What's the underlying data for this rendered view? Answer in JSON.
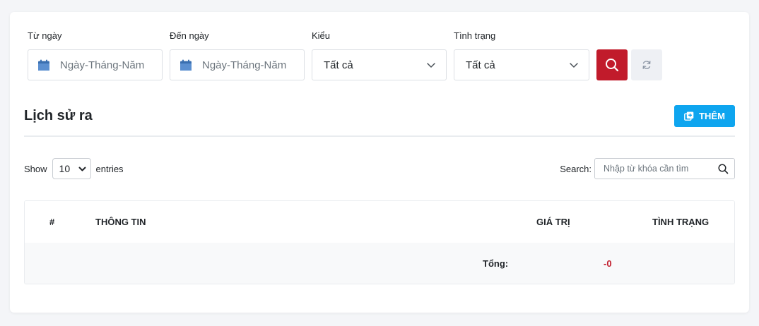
{
  "filters": {
    "from_date": {
      "label": "Từ ngày",
      "placeholder": "Ngày-Tháng-Năm"
    },
    "to_date": {
      "label": "Đến ngày",
      "placeholder": "Ngày-Tháng-Năm"
    },
    "type": {
      "label": "Kiểu",
      "value": "Tất cả"
    },
    "status": {
      "label": "Tình trạng",
      "value": "Tất cả"
    }
  },
  "section": {
    "title": "Lịch sử ra",
    "add_label": "THÊM"
  },
  "table_controls": {
    "show_label": "Show",
    "entries_value": "10",
    "entries_label": "entries",
    "search_label": "Search:",
    "search_placeholder": "Nhập từ khóa cần tìm"
  },
  "table": {
    "headers": [
      "#",
      "THÔNG TIN",
      "GIÁ TRỊ",
      "TÌNH TRẠNG"
    ],
    "footer": {
      "total_label": "Tổng:",
      "total_value": "-0"
    }
  },
  "colors": {
    "search_button": "#c11b2b",
    "add_button": "#0ea5ef",
    "calendar_icon": "#3a6fb0",
    "total_value": "#c11b2b"
  },
  "icons": {
    "date": "calendar-icon",
    "dropdown": "chevron-down-icon",
    "search": "search-icon",
    "reset": "refresh-icon",
    "add": "copy-plus-icon"
  }
}
